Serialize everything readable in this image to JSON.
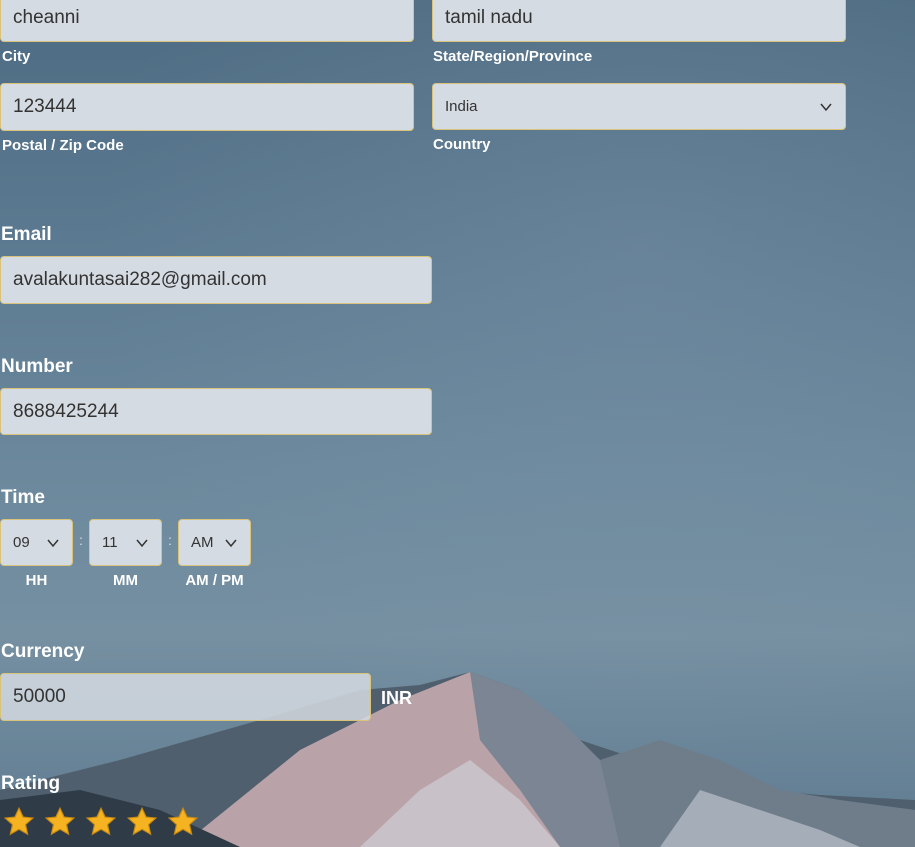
{
  "address": {
    "city": {
      "value": "cheanni",
      "label": "City"
    },
    "state": {
      "value": "tamil nadu",
      "label": "State/Region/Province"
    },
    "postal": {
      "value": "123444",
      "label": "Postal / Zip Code"
    },
    "country": {
      "value": "India",
      "label": "Country"
    }
  },
  "email": {
    "label": "Email",
    "value": "avalakuntasai282@gmail.com"
  },
  "number": {
    "label": "Number",
    "value": "8688425244"
  },
  "time": {
    "label": "Time",
    "hh": {
      "value": "09",
      "label": "HH"
    },
    "mm": {
      "value": "11",
      "label": "MM"
    },
    "ampm": {
      "value": "AM",
      "label": "AM / PM"
    },
    "separator": ":"
  },
  "currency": {
    "label": "Currency",
    "value": "50000",
    "unit": "INR"
  },
  "rating": {
    "label": "Rating",
    "value": 5,
    "max": 5,
    "star_color": "#f5b321"
  },
  "colors": {
    "field_bg": "#d5dbe2",
    "field_border": "#d9c37a"
  }
}
